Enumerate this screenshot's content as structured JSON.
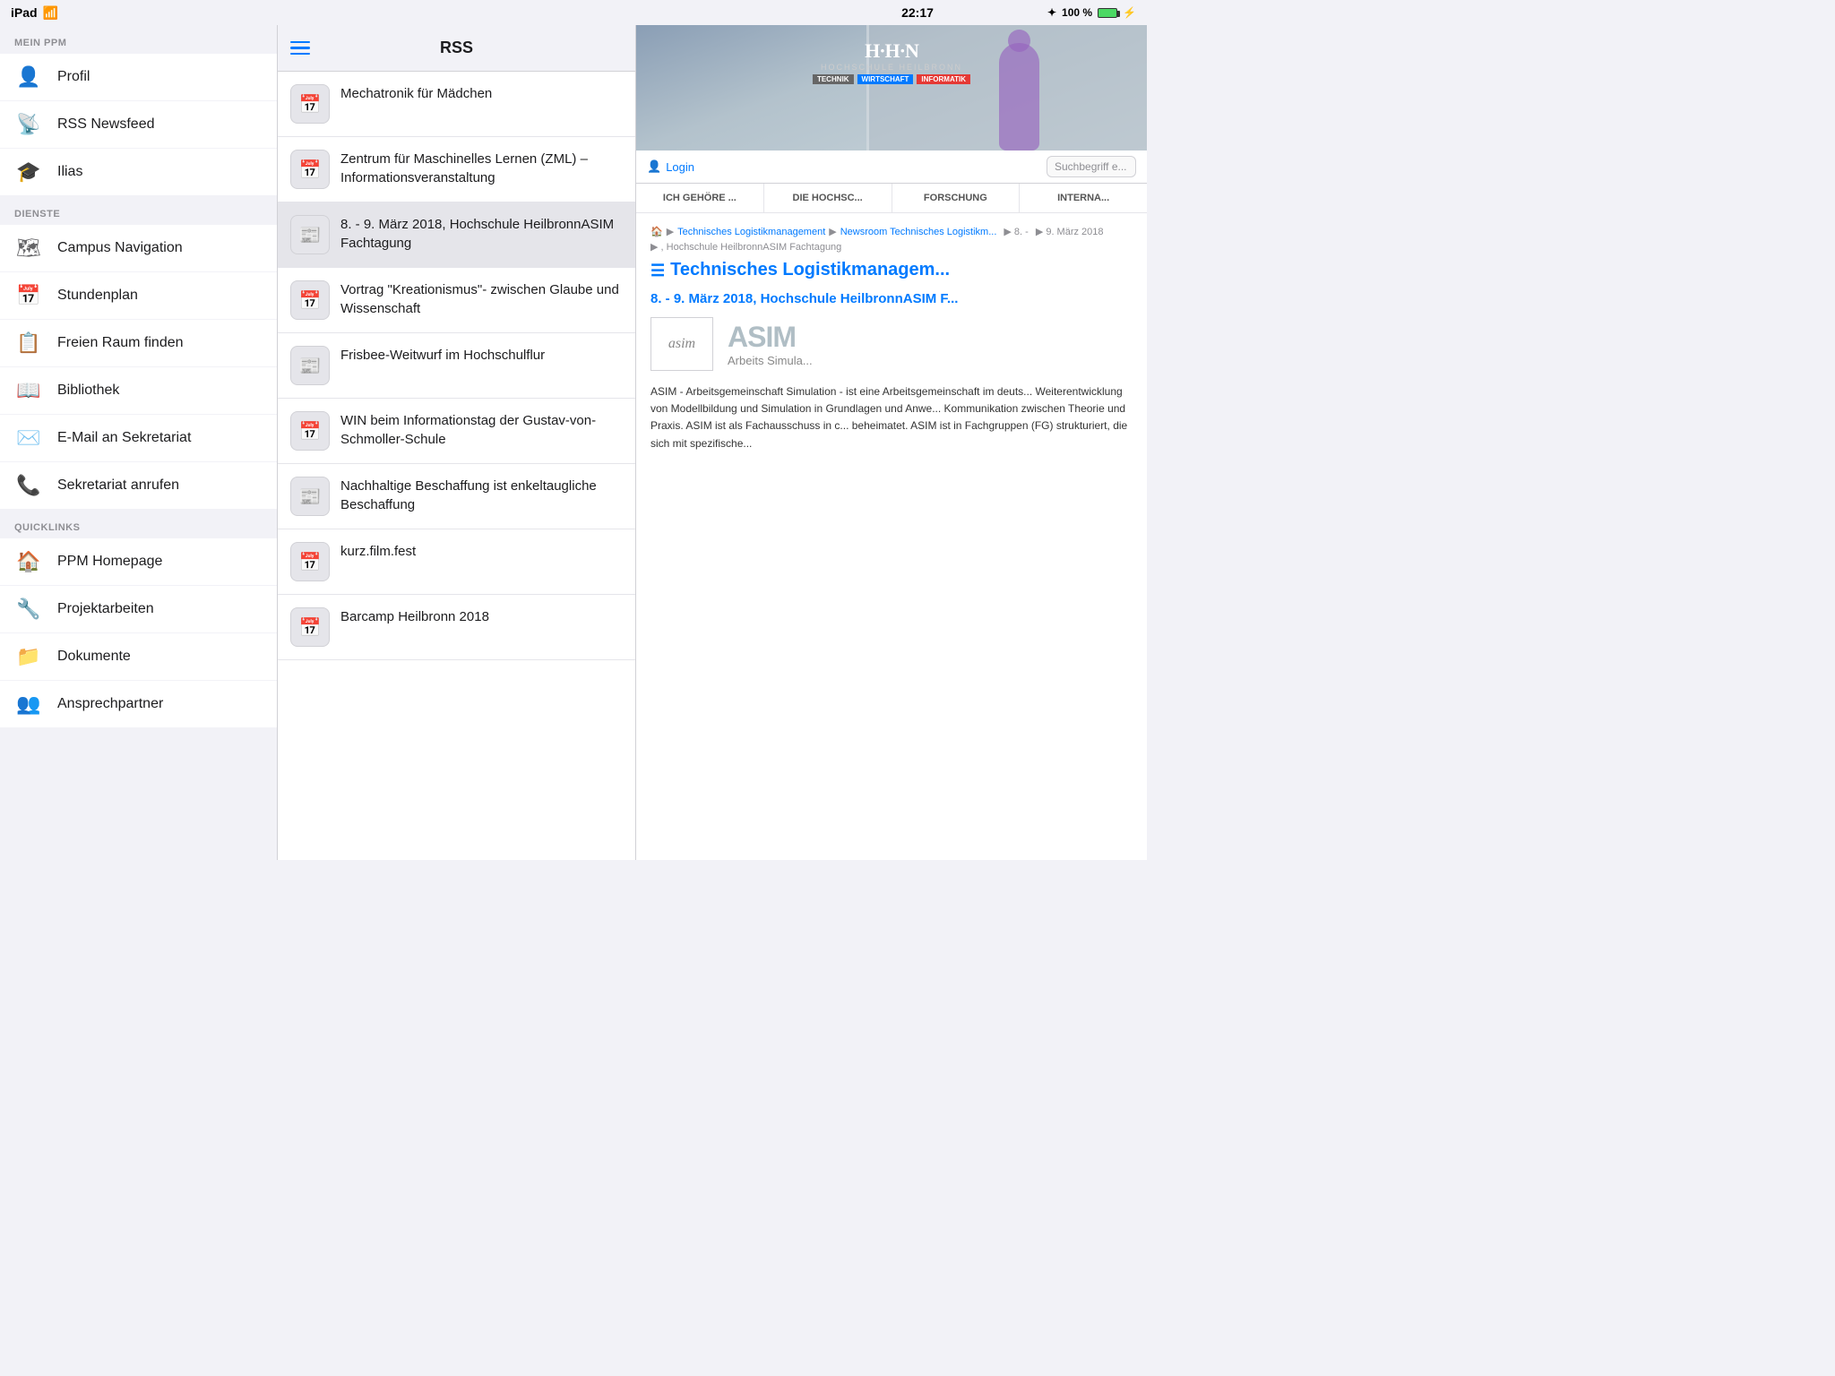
{
  "statusBar": {
    "left": "iPad",
    "time": "22:17",
    "bluetooth": "✦",
    "battery": "100 %"
  },
  "sidebar": {
    "sections": [
      {
        "label": "MEIN PPM",
        "items": [
          {
            "id": "profil",
            "label": "Profil",
            "icon": "person"
          },
          {
            "id": "rss",
            "label": "RSS Newsfeed",
            "icon": "rss"
          },
          {
            "id": "ilias",
            "label": "Ilias",
            "icon": "graduation"
          }
        ]
      },
      {
        "label": "DIENSTE",
        "items": [
          {
            "id": "campus",
            "label": "Campus Navigation",
            "icon": "map"
          },
          {
            "id": "stundenplan",
            "label": "Stundenplan",
            "icon": "calendar-grid"
          },
          {
            "id": "freiraum",
            "label": "Freien Raum finden",
            "icon": "table"
          },
          {
            "id": "bibliothek",
            "label": "Bibliothek",
            "icon": "book"
          },
          {
            "id": "email",
            "label": "E-Mail an Sekretariat",
            "icon": "envelope"
          },
          {
            "id": "telefon",
            "label": "Sekretariat anrufen",
            "icon": "phone"
          }
        ]
      },
      {
        "label": "QUICKLINKS",
        "items": [
          {
            "id": "ppmhome",
            "label": "PPM Homepage",
            "icon": "home"
          },
          {
            "id": "projekt",
            "label": "Projektarbeiten",
            "icon": "wrench"
          },
          {
            "id": "dokumente",
            "label": "Dokumente",
            "icon": "folder"
          },
          {
            "id": "ansprechpartner",
            "label": "Ansprechpartner",
            "icon": "people"
          }
        ]
      }
    ]
  },
  "rss": {
    "title": "RSS",
    "items": [
      {
        "id": 1,
        "type": "calendar",
        "text": "Mechatronik für Mädchen"
      },
      {
        "id": 2,
        "type": "calendar",
        "text": "Zentrum für Maschinelles Lernen (ZML) – Informationsveranstaltung"
      },
      {
        "id": 3,
        "type": "news",
        "text": "8. - 9. März 2018, Hochschule HeilbronnASIM Fachtagung",
        "selected": true
      },
      {
        "id": 4,
        "type": "calendar",
        "text": "Vortrag \"Kreationismus\"- zwischen Glaube und Wissenschaft"
      },
      {
        "id": 5,
        "type": "news",
        "text": "Frisbee-Weitwurf im Hochschulflur"
      },
      {
        "id": 6,
        "type": "calendar",
        "text": "WIN beim Informationstag der Gustav-von-Schmoller-Schule"
      },
      {
        "id": 7,
        "type": "news",
        "text": "Nachhaltige Beschaffung ist enkeltaugliche Beschaffung"
      },
      {
        "id": 8,
        "type": "calendar",
        "text": "kurz.film.fest"
      },
      {
        "id": 9,
        "type": "calendar",
        "text": "Barcamp Heilbronn 2018"
      }
    ]
  },
  "web": {
    "hhn": {
      "logoTitle": "H·H·N",
      "logoSubtitle": "Hochschule Heilbronn",
      "tags": [
        "Technik",
        "Wirtschaft",
        "Informatik"
      ],
      "loginLabel": "Login",
      "searchPlaceholder": "Suchbegriff e...",
      "navItems": [
        "ICH GEHÖRE ...",
        "DIE HOCHSC...",
        "FORSCHUNG",
        "INTERNA..."
      ],
      "breadcrumb": [
        "🏠",
        "▶",
        "Technisches Logistikmanagement",
        "▶",
        "Newsroom Technisches Logistikm...",
        "▶",
        "8. -",
        "▶",
        "9. März 2018",
        "▶",
        ", Hochschule HeilbronnASIM Fachtagung"
      ],
      "articleTitle": "Technisches Logistikmanagem...",
      "articleSubtitle": "8. - 9. März 2018, Hochschule HeilbronnASIM F...",
      "asimLabel": "ASIM",
      "asimSub": "Arbeits\nSimula...",
      "asimLogoText": "asim",
      "bodyText": "ASIM - Arbeitsgemeinschaft Simulation - ist eine Arbeitsgemeinschaft im deuts... Weiterentwicklung von Modellbildung und Simulation in Grundlagen und Anwe... Kommunikation zwischen Theorie und Praxis. ASIM ist als Fachausschuss in c... beheimatet. ASIM ist in Fachgruppen (FG) strukturiert, die sich mit spezifische..."
    }
  }
}
